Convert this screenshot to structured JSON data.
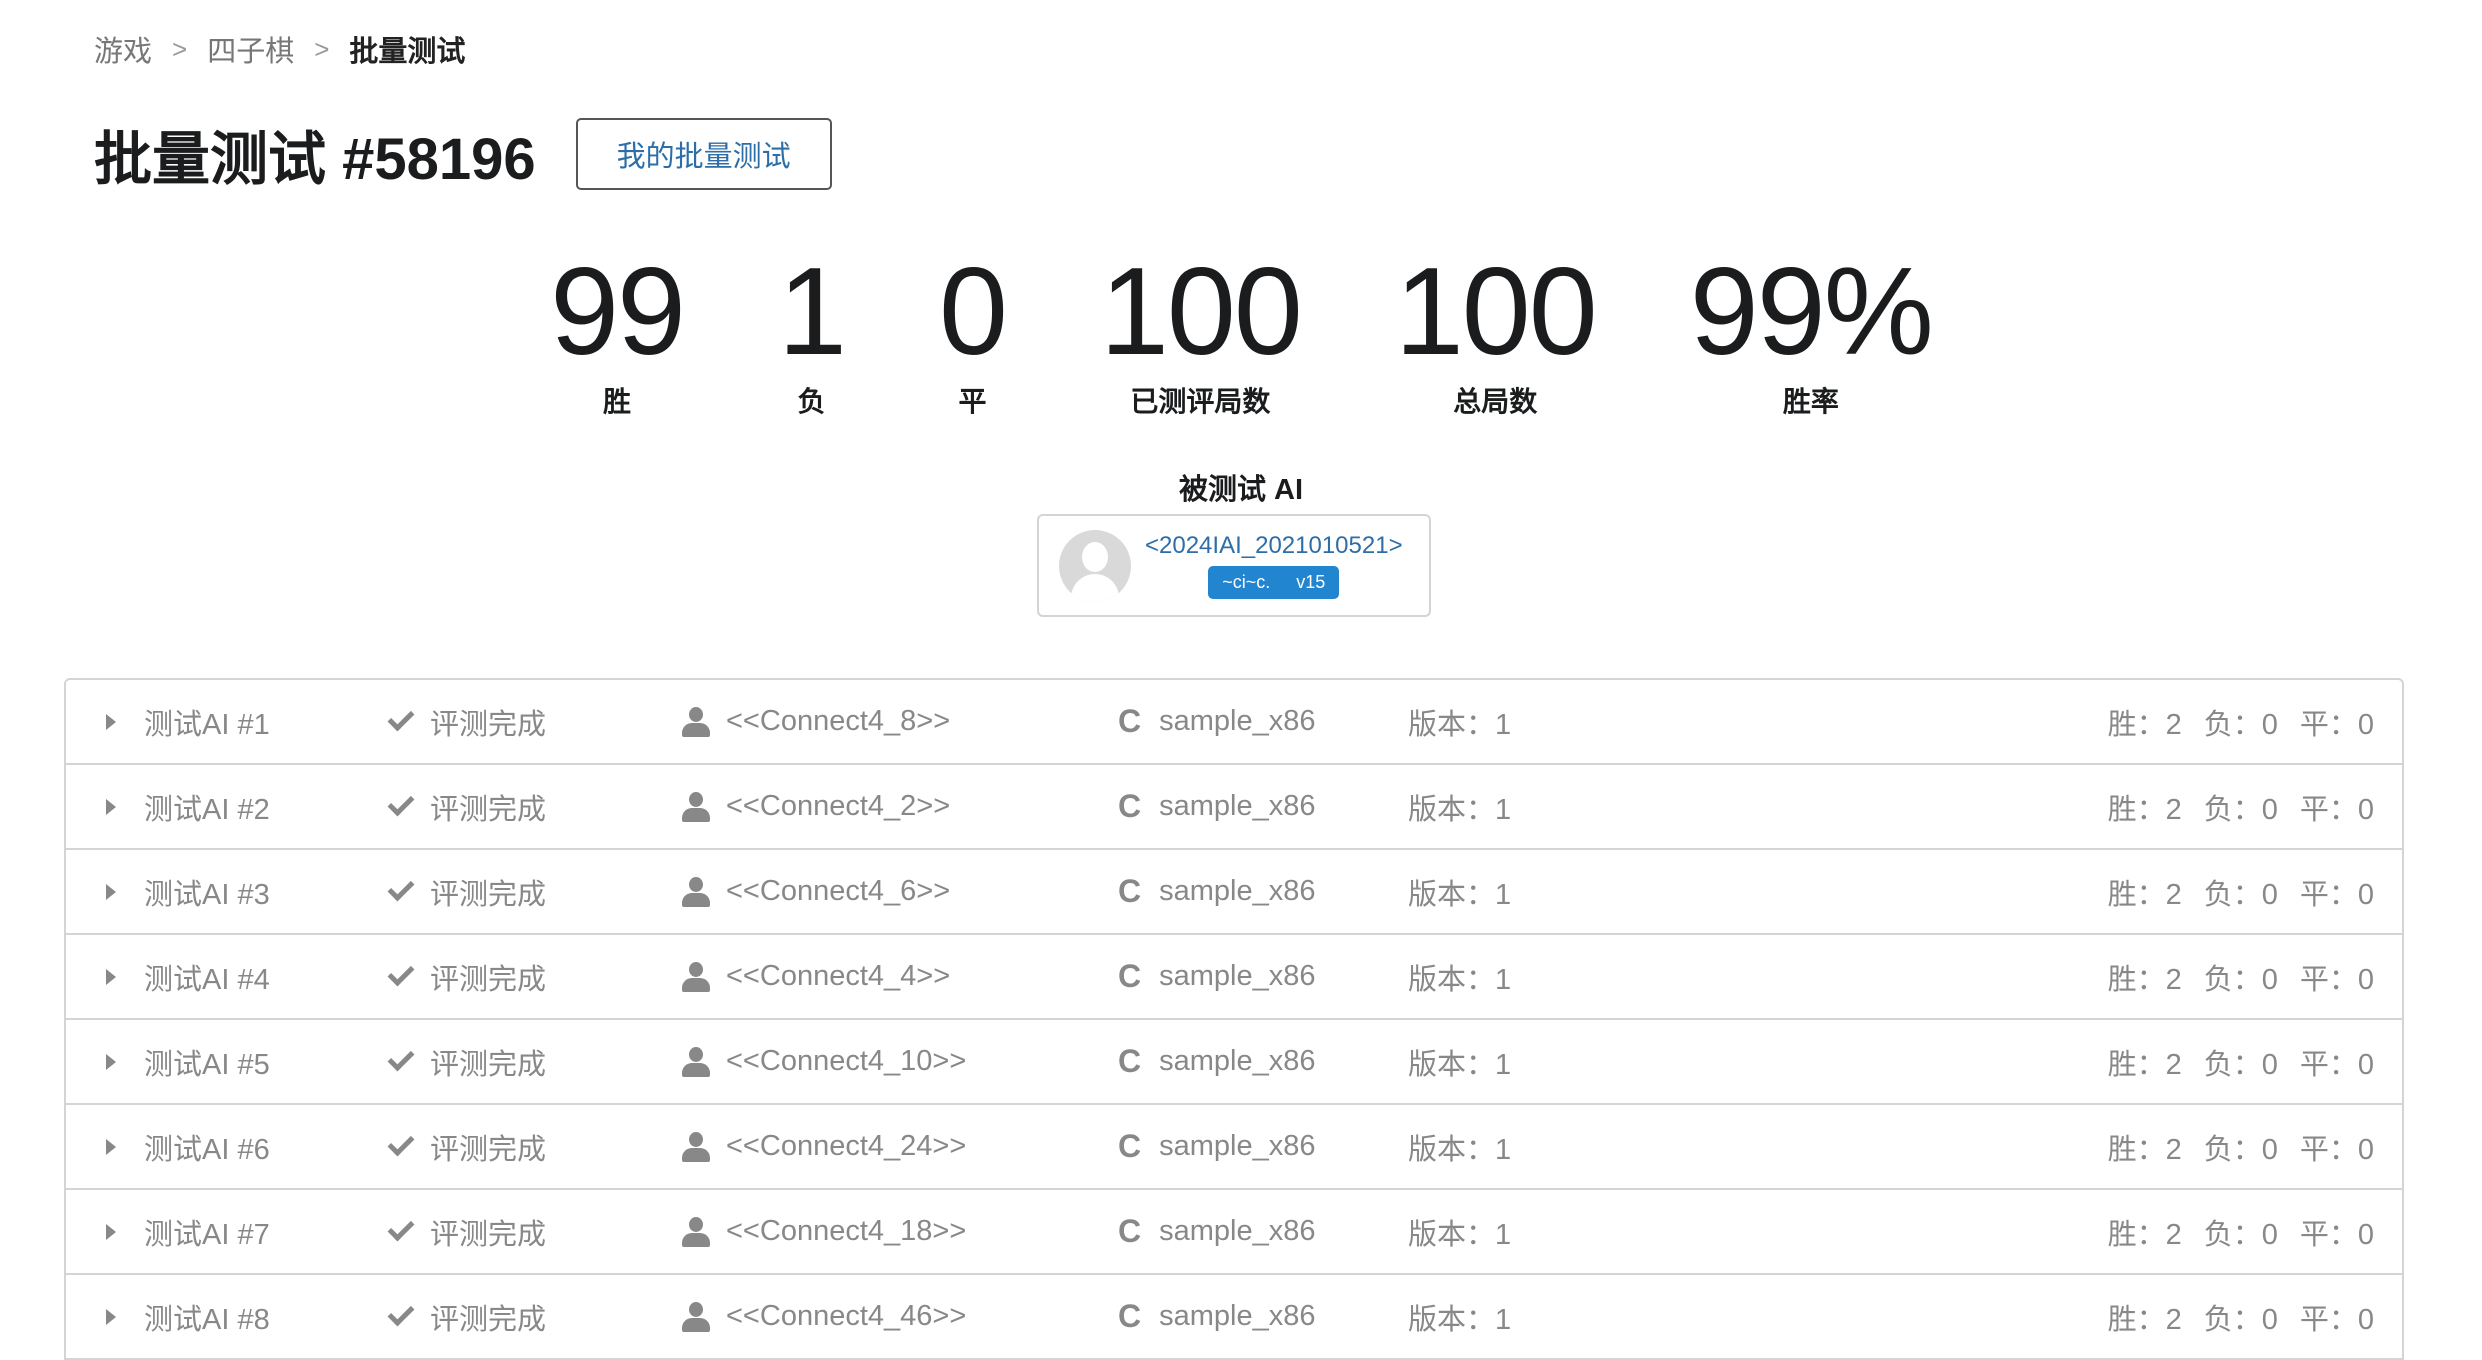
{
  "breadcrumb": {
    "items": [
      "游戏",
      "四子棋"
    ],
    "current": "批量测试",
    "separator": ">"
  },
  "header": {
    "title": "批量测试 #58196",
    "my_batch_button": "我的批量测试"
  },
  "stats": [
    {
      "value": "99",
      "label": "胜"
    },
    {
      "value": "1",
      "label": "负"
    },
    {
      "value": "0",
      "label": "平"
    },
    {
      "value": "100",
      "label": "已测评局数"
    },
    {
      "value": "100",
      "label": "总局数"
    },
    {
      "value": "99%",
      "label": "胜率"
    }
  ],
  "tested_ai": {
    "label": "被测试 AI",
    "name": "<2024IAI_2021010521>",
    "tag_user": "~ci~c.",
    "tag_version": "v15"
  },
  "rows": [
    {
      "title": "测试AI #1",
      "status": "评测完成",
      "owner": "<<Connect4_8>>",
      "lang": "sample_x86",
      "version": "版本：1",
      "win": "胜：2",
      "lose": "负：0",
      "draw": "平：0"
    },
    {
      "title": "测试AI #2",
      "status": "评测完成",
      "owner": "<<Connect4_2>>",
      "lang": "sample_x86",
      "version": "版本：1",
      "win": "胜：2",
      "lose": "负：0",
      "draw": "平：0"
    },
    {
      "title": "测试AI #3",
      "status": "评测完成",
      "owner": "<<Connect4_6>>",
      "lang": "sample_x86",
      "version": "版本：1",
      "win": "胜：2",
      "lose": "负：0",
      "draw": "平：0"
    },
    {
      "title": "测试AI #4",
      "status": "评测完成",
      "owner": "<<Connect4_4>>",
      "lang": "sample_x86",
      "version": "版本：1",
      "win": "胜：2",
      "lose": "负：0",
      "draw": "平：0"
    },
    {
      "title": "测试AI #5",
      "status": "评测完成",
      "owner": "<<Connect4_10>>",
      "lang": "sample_x86",
      "version": "版本：1",
      "win": "胜：2",
      "lose": "负：0",
      "draw": "平：0"
    },
    {
      "title": "测试AI #6",
      "status": "评测完成",
      "owner": "<<Connect4_24>>",
      "lang": "sample_x86",
      "version": "版本：1",
      "win": "胜：2",
      "lose": "负：0",
      "draw": "平：0"
    },
    {
      "title": "测试AI #7",
      "status": "评测完成",
      "owner": "<<Connect4_18>>",
      "lang": "sample_x86",
      "version": "版本：1",
      "win": "胜：2",
      "lose": "负：0",
      "draw": "平：0"
    },
    {
      "title": "测试AI #8",
      "status": "评测完成",
      "owner": "<<Connect4_46>>",
      "lang": "sample_x86",
      "version": "版本：1",
      "win": "胜：2",
      "lose": "负：0",
      "draw": "平：0"
    }
  ]
}
